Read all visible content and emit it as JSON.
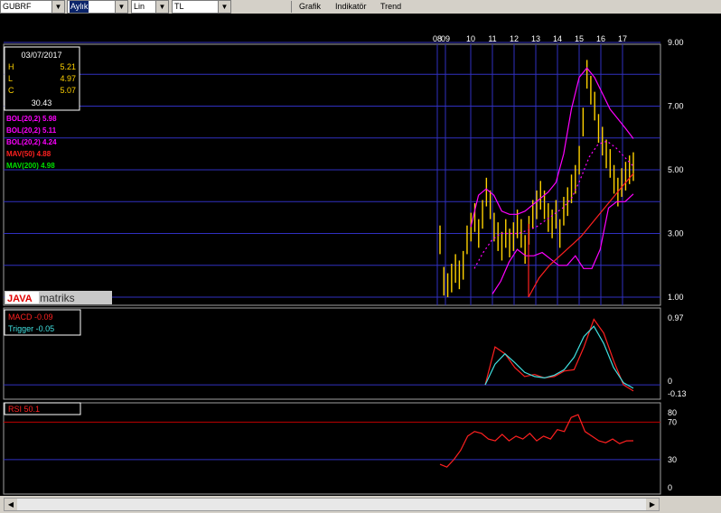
{
  "toolbar": {
    "symbol": "GUBRF",
    "period": "Aylık",
    "scale": "Lin",
    "currency": "TL",
    "menu": [
      "Grafik",
      "Indikatör",
      "Trend"
    ]
  },
  "info_box": {
    "date": "03/07/2017",
    "h_label": "H",
    "h_value": "5.21",
    "l_label": "L",
    "l_value": "4.97",
    "c_label": "C",
    "c_value": "5.07",
    "volume": "30.43"
  },
  "legend": [
    {
      "text": "BOL(20,2) 5.98",
      "color": "#ff00ff"
    },
    {
      "text": "BOL(20,2) 5.11",
      "color": "#ff00ff"
    },
    {
      "text": "BOL(20,2) 4.24",
      "color": "#ff00ff"
    },
    {
      "text": "MAV(50) 4.88",
      "color": "#ff2020"
    },
    {
      "text": "MAV(200) 4.98",
      "color": "#00e000"
    }
  ],
  "macd_legend": [
    {
      "text": "MACD -0.09",
      "color": "#ff2020"
    },
    {
      "text": "Trigger -0.05",
      "color": "#40e0e0"
    }
  ],
  "rsi_legend": {
    "text": "RSI 50.1",
    "color": "#ff2020"
  },
  "logo": {
    "part1": "JAVA",
    "part2": "matriks"
  },
  "colors": {
    "price": "#ffd200",
    "grid": "#3030c0",
    "bollinger": "#ff00ff",
    "mav50": "#ff2020",
    "macd": "#ff2020",
    "trigger": "#40e0e0",
    "rsi": "#ff2020"
  },
  "chart_data": [
    {
      "type": "line",
      "title": "GUBRF",
      "x_ticks": [
        "08",
        "09",
        "10",
        "11",
        "12",
        "13",
        "14",
        "15",
        "16",
        "17"
      ],
      "y_ticks": [
        "9.00",
        "7.00",
        "5.00",
        "3.00",
        "1.00"
      ],
      "ylim": [
        1,
        9
      ],
      "grid": true,
      "series": [
        {
          "name": "Price",
          "values": [
            2.8,
            1.5,
            1.3,
            1.6,
            1.9,
            1.7,
            2.0,
            2.8,
            3.2,
            3.5,
            3.0,
            3.6,
            4.3,
            3.9,
            3.2,
            2.9,
            2.6,
            3.0,
            2.7,
            2.9,
            3.3,
            3.0,
            2.5,
            3.1,
            3.6,
            3.9,
            4.2,
            3.9,
            3.5,
            3.3,
            3.6,
            3.0,
            3.7,
            4.0,
            4.4,
            4.7,
            5.3,
            6.5,
            8.0,
            7.5,
            7.0,
            6.3,
            5.9,
            5.5,
            5.2,
            4.7,
            4.3,
            4.6,
            4.8,
            5.0,
            5.1
          ]
        },
        {
          "name": "BOL(20,2)",
          "values": [
            3.2,
            4.2,
            4.4,
            4.2,
            3.7,
            3.6,
            3.6,
            3.7,
            3.9,
            4.1,
            4.3,
            4.6,
            5.5,
            6.9,
            7.9,
            8.2,
            7.9,
            7.4,
            6.9,
            6.6,
            6.3,
            5.98
          ]
        },
        {
          "name": "BOL(20,2)",
          "values": [
            1.9,
            2.4,
            2.8,
            3.0,
            3.0,
            3.0,
            3.1,
            3.2,
            3.4,
            3.6,
            3.8,
            4.1,
            4.7,
            5.4,
            5.8,
            5.9,
            5.7,
            5.4,
            5.11
          ]
        },
        {
          "name": "BOL(20,2)",
          "values": [
            1.1,
            1.5,
            2.1,
            2.5,
            2.3,
            2.3,
            2.4,
            2.2,
            2.0,
            2.0,
            2.3,
            1.9,
            1.9,
            2.5,
            3.8,
            4.0,
            4.0,
            4.24
          ]
        },
        {
          "name": "MAV(50)",
          "values": [
            1.0,
            1.6,
            2.0,
            2.3,
            2.6,
            2.9,
            3.3,
            3.7,
            4.1,
            4.5,
            4.88
          ]
        }
      ]
    },
    {
      "type": "line",
      "y_ticks": [
        "0.97",
        "0",
        "-0.13"
      ],
      "ylim": [
        -0.13,
        0.97
      ],
      "series": [
        {
          "name": "MACD",
          "values": [
            0.0,
            0.55,
            0.45,
            0.25,
            0.12,
            0.15,
            0.1,
            0.12,
            0.2,
            0.22,
            0.55,
            0.95,
            0.75,
            0.35,
            0.0,
            -0.09
          ]
        },
        {
          "name": "Trigger",
          "values": [
            0.0,
            0.3,
            0.45,
            0.32,
            0.18,
            0.12,
            0.1,
            0.14,
            0.22,
            0.4,
            0.7,
            0.85,
            0.6,
            0.25,
            0.03,
            -0.05
          ]
        }
      ]
    },
    {
      "type": "line",
      "y_ticks": [
        "80",
        "70",
        "30",
        "0"
      ],
      "ylim": [
        0,
        80
      ],
      "series": [
        {
          "name": "RSI",
          "values": [
            25,
            22,
            30,
            40,
            55,
            60,
            58,
            52,
            50,
            57,
            50,
            55,
            52,
            58,
            50,
            55,
            52,
            62,
            60,
            75,
            78,
            60,
            55,
            50,
            48,
            52,
            47,
            50,
            50.1
          ]
        }
      ]
    }
  ]
}
